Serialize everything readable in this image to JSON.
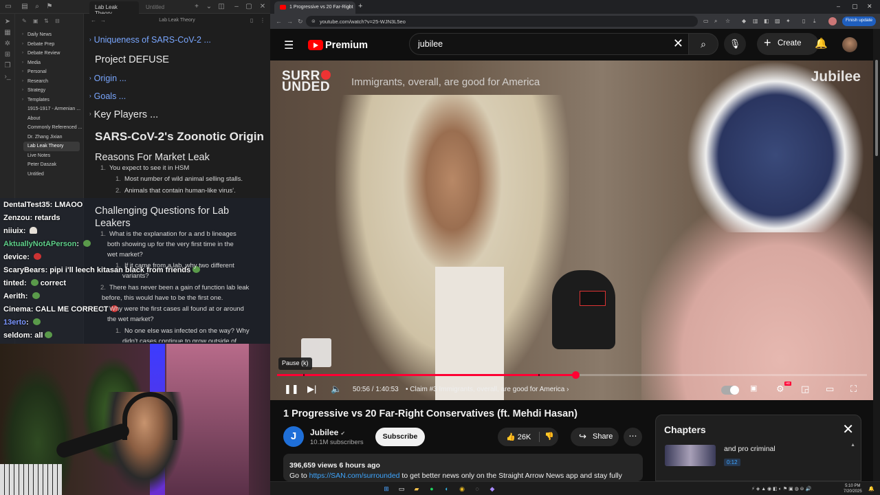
{
  "obsidian": {
    "tabs": [
      {
        "label": "Lab Leak Theory",
        "active": true
      },
      {
        "label": "Untitled",
        "active": false
      }
    ],
    "note_title": "Lab Leak Theory",
    "folders": [
      "Daily News",
      "Debate Prep",
      "Debate Review",
      "Media",
      "Personal",
      "Research",
      "Strategy",
      "Templates"
    ],
    "files": [
      "1915-1917 - Armenian ...",
      "About",
      "Commonly Referenced ...",
      "Dr. Zhang Jixian",
      "Lab Leak Theory",
      "Live Notes",
      "Peter Daszak",
      "Untitled"
    ],
    "active_file": "Lab Leak Theory",
    "outline": {
      "h_uniqueness": "Uniqueness of SARS-CoV-2 ...",
      "h_defuse": "Project DEFUSE",
      "h_origin": "Origin ...",
      "h_goals": "Goals ...",
      "h_key_players": "Key Players ...",
      "h_zoonotic": "SARS-CoV-2's Zoonotic Origin",
      "h_market": "Reasons For Market Leak",
      "market_items": {
        "l1": "You expect to see it in HSM",
        "l1_1": "Most number of wild animal selling stalls.",
        "l1_2": "Animals that contain human-like virus'."
      },
      "h_questions": "Challenging Questions for Lab Leakers",
      "questions": {
        "q1_a": "What is the explanation for a and b lineages",
        "q1_b": "both showing up for the very first time in the",
        "q1_c": "wet market?",
        "q1_1_a": "If it came from a lab, why two different",
        "q1_1_b": "variants?",
        "q2_a": "There has never been a gain of function lab leak",
        "q2_b": "before, this would have to be the first one.",
        "q3_a": "Why were the first cases all found at or around",
        "q3_b": "the wet market?",
        "q3_1_a": "No one else was infected on the way? Why",
        "q3_1_b": "didn't cases continue to grow outside of"
      }
    }
  },
  "chat": [
    {
      "user": "DentalTest35",
      "msg": "LMAOO",
      "color": "default",
      "emote": ""
    },
    {
      "user": "Zenzou",
      "msg": "retards",
      "color": "default",
      "emote": ""
    },
    {
      "user": "niiuix",
      "msg": "",
      "color": "default",
      "emote": "ghost"
    },
    {
      "user": "AktuallyNotAPerson",
      "msg": "",
      "color": "green",
      "emote": "frog"
    },
    {
      "user": "device",
      "msg": "",
      "color": "default",
      "emote": "rose"
    },
    {
      "user": "ScaryBears",
      "msg": "pipi i'll leech kitasan black from friends",
      "color": "default",
      "emote": "frog"
    },
    {
      "user": "tinted",
      "msg": "correct",
      "color": "default",
      "emote": "frog"
    },
    {
      "user": "Aerith",
      "msg": "",
      "color": "default",
      "emote": "frog"
    },
    {
      "user": "Cinema",
      "msg": "CALL ME CORRECT",
      "color": "default",
      "emote": "rose"
    },
    {
      "user": "13erto",
      "msg": "",
      "color": "blue",
      "emote": "frog"
    },
    {
      "user": "seldom",
      "msg": "all",
      "color": "default",
      "emote": "frog"
    }
  ],
  "browser": {
    "tab_title": "1 Progressive vs 20 Far-Right",
    "url": "youtube.com/watch?v=25-WJN3L5eo",
    "finish_update": "Finish update"
  },
  "youtube": {
    "logo_text": "Premium",
    "search_value": "jubilee",
    "create_label": "Create",
    "player": {
      "watermark_surr": "SURR",
      "watermark_unded": "UNDED",
      "claim_text": "Immigrants, overall, are good for America",
      "jubilee_watermark": "Jubilee",
      "tooltip": "Pause (k)",
      "current_time": "50:56",
      "duration": "1:40:53",
      "chapter": "Claim #3 Immigrants, overall, are good for America",
      "progress_played": 0.506,
      "progress_buffered": 0.444
    },
    "video_title": "1 Progressive vs 20 Far-Right Conservatives (ft. Mehdi Hasan)",
    "channel": {
      "name": "Jubilee",
      "subscribers": "10.1M subscribers",
      "avatar_letter": "J"
    },
    "subscribe_label": "Subscribe",
    "likes": "26K",
    "share_label": "Share",
    "description": {
      "stats": "396,659 views  6 hours ago",
      "prefix": "Go to ",
      "link": "https://SAN.com/surrounded",
      "suffix": " to get better news only on the Straight Arrow News app and stay fully"
    },
    "chapters_panel": {
      "title": "Chapters",
      "chapter_name": "and pro criminal",
      "chapter_time": "0:12"
    }
  },
  "taskbar": {
    "time": "5:10 PM",
    "date": "7/20/2025"
  },
  "colors": {
    "youtube_red": "#ff0033",
    "link_blue": "#3ea6ff",
    "obsidian_heading_blue": "#7aa7ff",
    "chat_green": "#5fd08a",
    "finish_update_blue": "#1f5fbf"
  }
}
